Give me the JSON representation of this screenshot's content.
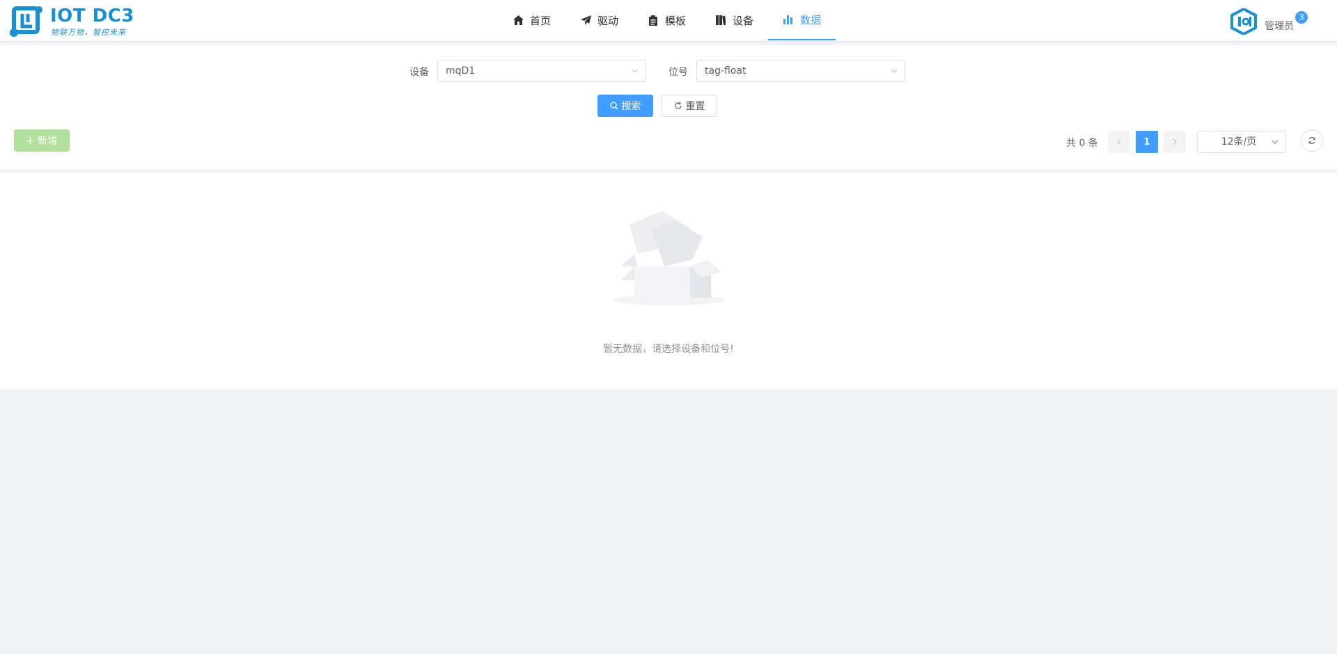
{
  "app": {
    "logo_title": "IOT DC3",
    "logo_subtitle": "物联万物，智控未来"
  },
  "nav": {
    "items": [
      {
        "label": "首页",
        "icon": "home-icon"
      },
      {
        "label": "驱动",
        "icon": "send-icon"
      },
      {
        "label": "模板",
        "icon": "clipboard-icon"
      },
      {
        "label": "设备",
        "icon": "book-icon"
      },
      {
        "label": "数据",
        "icon": "bar-chart-icon",
        "active": true
      }
    ]
  },
  "user": {
    "name": "管理员",
    "badge": "3"
  },
  "search": {
    "device_label": "设备",
    "device_value": "mqD1",
    "point_label": "位号",
    "point_value": "tag-float",
    "search_button": "搜索",
    "reset_button": "重置"
  },
  "toolbar": {
    "add_button": "新增",
    "total_text": "共 0 条",
    "current_page": "1",
    "page_size": "12条/页"
  },
  "empty": {
    "text": "暂无数据，请选择设备和位号!"
  },
  "colors": {
    "primary": "#409eff",
    "logo": "#1890d4",
    "success_disabled": "#b3e19d"
  }
}
